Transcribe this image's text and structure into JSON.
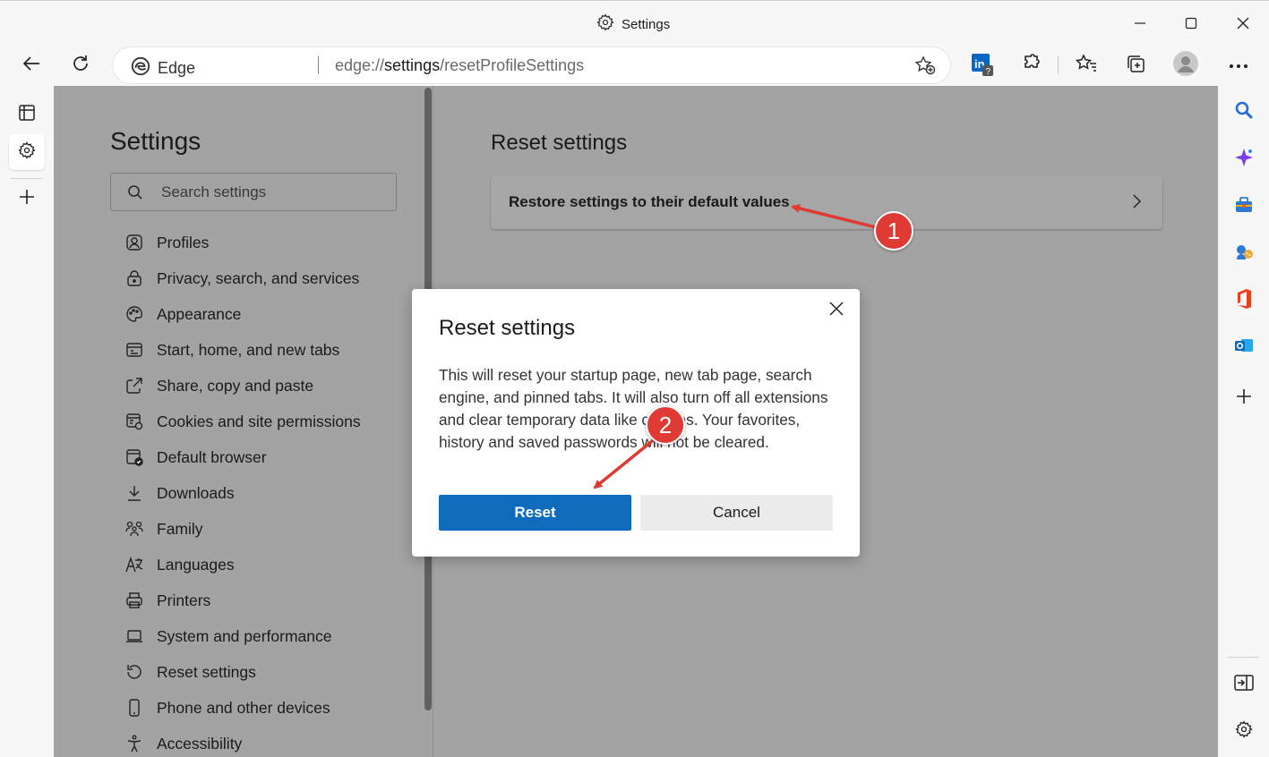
{
  "window": {
    "title": "Settings",
    "controls": {
      "minimize": "minimize",
      "maximize": "maximize",
      "close": "close"
    }
  },
  "toolbar": {
    "address": {
      "site_label": "Edge",
      "url_prefix": "edge://",
      "url_strong": "settings",
      "url_path": "/resetProfileSettings"
    },
    "icons": [
      "back-icon",
      "refresh-icon",
      "favorite-add-icon",
      "linkedin-icon",
      "extensions-icon",
      "favorites-icon",
      "collections-icon",
      "profile-avatar",
      "more-icon"
    ]
  },
  "left_rail": {
    "icons": [
      "tab-actions-icon",
      "settings-icon",
      "new-tab-icon"
    ]
  },
  "right_rail": {
    "icons": [
      "search-icon",
      "copilot-icon",
      "tools-icon",
      "games-icon",
      "office-icon",
      "outlook-icon",
      "add-icon",
      "hide-sidebar-icon",
      "sidebar-settings-icon"
    ]
  },
  "sidebar": {
    "title": "Settings",
    "search_placeholder": "Search settings",
    "items": [
      {
        "label": "Profiles",
        "icon": "profile-icon"
      },
      {
        "label": "Privacy, search, and services",
        "icon": "lock-icon"
      },
      {
        "label": "Appearance",
        "icon": "palette-icon"
      },
      {
        "label": "Start, home, and new tabs",
        "icon": "home-tabs-icon"
      },
      {
        "label": "Share, copy and paste",
        "icon": "share-icon"
      },
      {
        "label": "Cookies and site permissions",
        "icon": "cookies-icon"
      },
      {
        "label": "Default browser",
        "icon": "browser-icon"
      },
      {
        "label": "Downloads",
        "icon": "download-icon"
      },
      {
        "label": "Family",
        "icon": "family-icon"
      },
      {
        "label": "Languages",
        "icon": "languages-icon"
      },
      {
        "label": "Printers",
        "icon": "printer-icon"
      },
      {
        "label": "System and performance",
        "icon": "system-icon"
      },
      {
        "label": "Reset settings",
        "icon": "reset-icon"
      },
      {
        "label": "Phone and other devices",
        "icon": "phone-icon"
      },
      {
        "label": "Accessibility",
        "icon": "accessibility-icon"
      }
    ]
  },
  "main": {
    "heading": "Reset settings",
    "restore_card_label": "Restore settings to their default values"
  },
  "dialog": {
    "title": "Reset settings",
    "body": "This will reset your startup page, new tab page, search engine, and pinned tabs. It will also turn off all extensions and clear temporary data like cookies. Your favorites, history and saved passwords will not be cleared.",
    "reset_label": "Reset",
    "cancel_label": "Cancel"
  },
  "annotations": {
    "marker1": "1",
    "marker2": "2",
    "color": "#e03a35"
  },
  "colors": {
    "accent": "#0f6cbd",
    "dim_overlay": "#a3a3a3"
  }
}
